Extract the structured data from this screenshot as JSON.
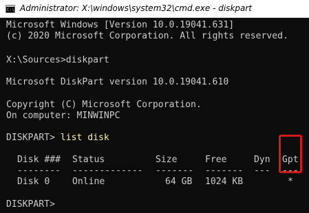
{
  "window": {
    "title": "Administrator: X:\\windows\\system32\\cmd.exe - diskpart",
    "icon_name": "cmd-icon",
    "icon_text": "C:\\."
  },
  "console": {
    "lines": [
      "Microsoft Windows [Version 10.0.19041.631]",
      "(c) 2020 Microsoft Corporation. All rights reserved.",
      "",
      "X:\\Sources>diskpart",
      "",
      "Microsoft DiskPart version 10.0.19041.610",
      "",
      "Copyright (C) Microsoft Corporation.",
      "On computer: MINWINPC",
      "",
      "DISKPART> "
    ],
    "command": "list disk",
    "final_prompt": "DISKPART>",
    "text_color": "#cccccc",
    "command_color": "#f9f1a5",
    "background": "#0c0c0c"
  },
  "table": {
    "headers": [
      "Disk ###",
      "Status",
      "Size",
      "Free",
      "Dyn",
      "Gpt"
    ],
    "separators": [
      "--------",
      "-------------",
      "-------",
      "-------",
      "---",
      "---"
    ],
    "rows": [
      [
        "Disk 0",
        "Online",
        "64 GB",
        "1024 KB",
        "",
        "*"
      ]
    ]
  },
  "annotation": {
    "highlight_color": "#d11a1a",
    "highlighted_column": "Gpt"
  }
}
